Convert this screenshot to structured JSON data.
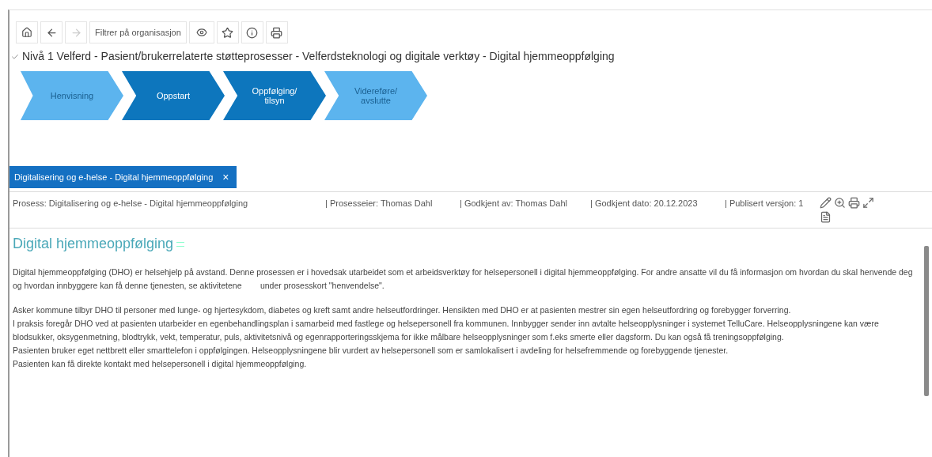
{
  "toolbar": {
    "filter_button": "Filtrer på organisasjon"
  },
  "breadcrumb": "Nivå 1 Velferd - Pasient/brukerrelaterte støtteprosesser - Velferdsteknologi og digitale verktøy - Digital hjemmeoppfølging",
  "steps": [
    {
      "label": "Henvisning",
      "active": false
    },
    {
      "label": "Oppstart",
      "active": true
    },
    {
      "label": "Oppfølging/ tilsyn",
      "active": true
    },
    {
      "label": "Videreføre/ avslutte",
      "active": false
    }
  ],
  "tab": {
    "label": "Digitalisering og e-helse - Digital hjemmeoppfølging",
    "close": "×",
    "selected": true
  },
  "info": [
    "Prosess: Digitalisering og e-helse - Digital hjemmeoppfølging",
    "| Prosesseier: Thomas Dahl",
    "| Godkjent av: Thomas Dahl",
    "| Godkjent dato: 20.12.2023",
    "| Publisert versjon: 1"
  ],
  "heading": "Digital hjemmeoppfølging",
  "paragraphs": [
    "Digital hjemmeoppfølging (DHO) er helsehjelp på avstand. Denne prosessen er i hovedsak utarbeidet som et arbeidsverktøy for helsepersonell i digital hjemmeoppfølging. For andre ansatte vil du få informasjon om hvordan du skal henvende deg og hvordan innbyggere kan få denne tjenesten, se aktivitetene        under prosesskort \"henvendelse\".",
    "Asker kommune tilbyr DHO til personer med lunge- og hjertesykdom, diabetes og kreft samt andre helseutfordringer. Hensikten med DHO er at pasienten mestrer sin egen helseutfordring og forebygger forverring.\nI praksis foregår DHO ved at pasienten utarbeider en egenbehandlingsplan i samarbeid med fastlege og helsepersonell fra kommunen. Innbygger sender inn avtalte helseopplysninger i systemet TelluCare. Helseopplysningene kan være blodsukker, oksygenmetning, blodtrykk, vekt, temperatur, puls, aktivitetsnivå og egenrapporteringsskjema for ikke målbare helseopplysninger som f.eks smerte eller dagsform. Du kan også få treningsoppfølging.\nPasienten bruker eget nettbrett eller smarttelefon i oppfølgingen. Helseopplysningene blir vurdert av helsepersonell som er samlokalisert i avdeling for helsefremmende og forebyggende tjenester.\nPasienten kan få direkte kontakt med helsepersonell i digital hjemmeoppfølging."
  ]
}
